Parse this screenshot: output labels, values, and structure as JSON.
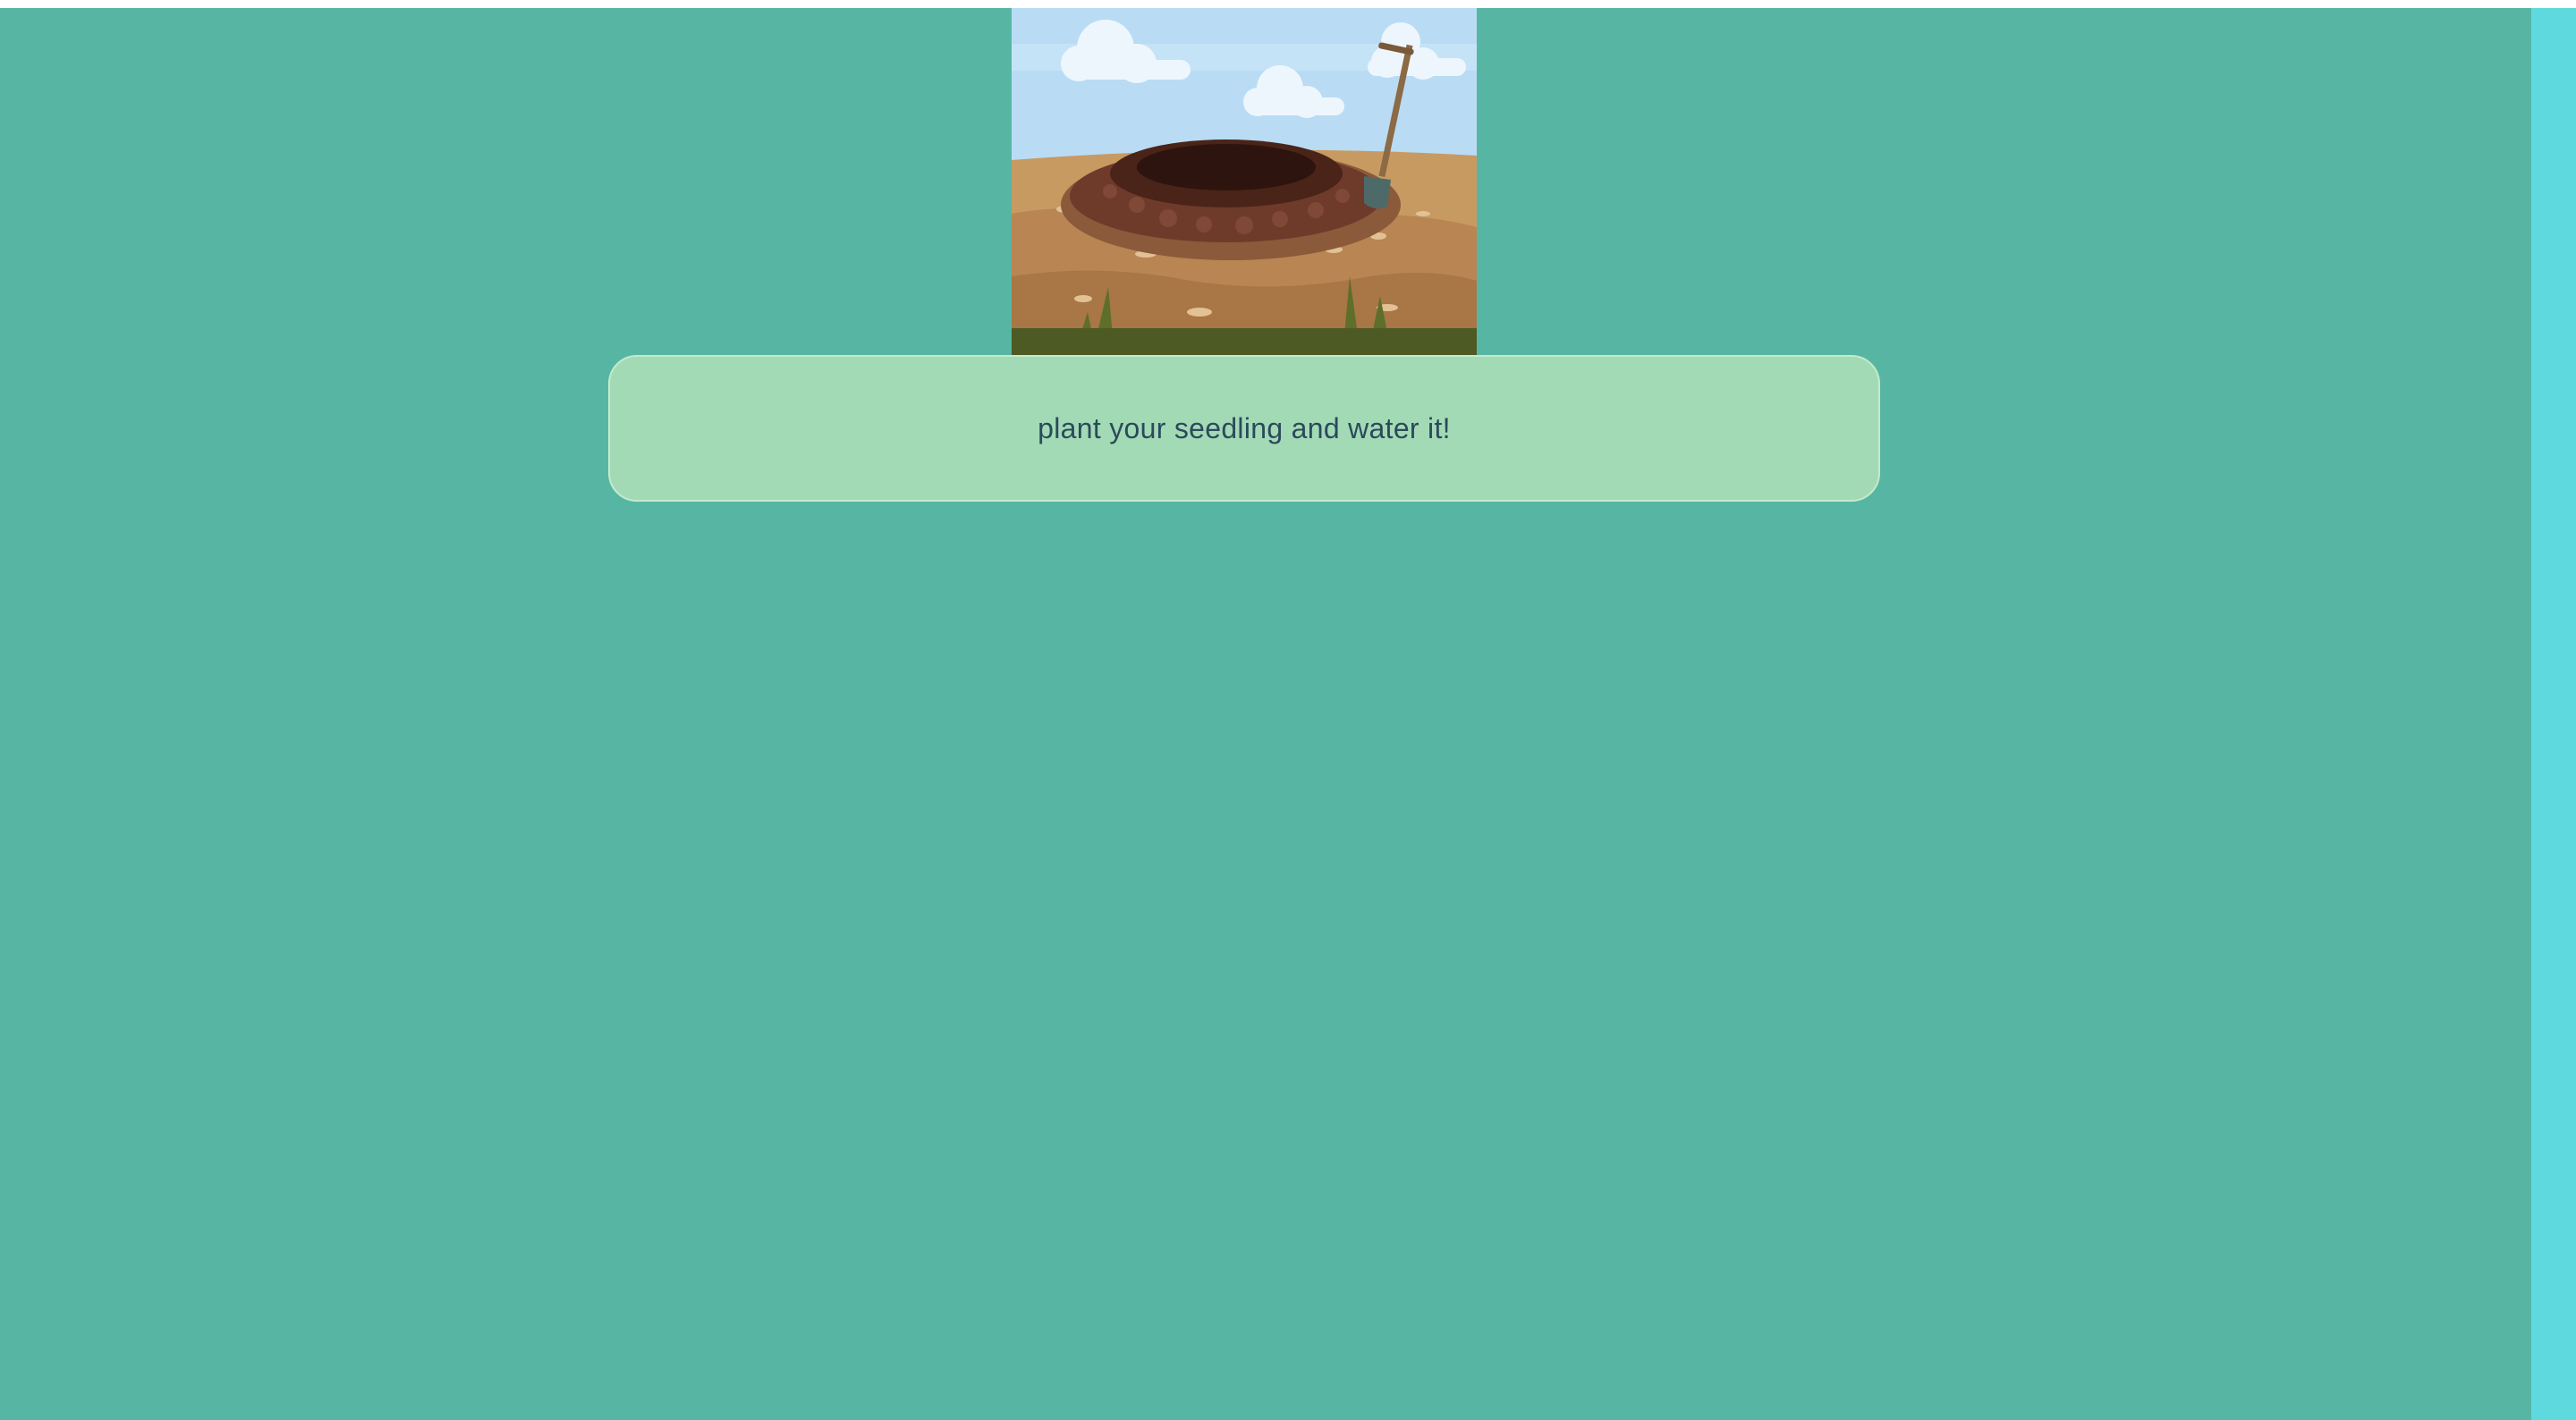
{
  "scene": {
    "image_icon": "garden-soil-mound-with-shovel-illustration"
  },
  "message": {
    "text": "plant your seedling and water it!"
  },
  "colors": {
    "background": "#57b6a3",
    "message_box": "#a3dab6",
    "message_border": "#c3eacd",
    "message_text": "#2b4a5a",
    "scrollbar": "#5ed9dd"
  }
}
